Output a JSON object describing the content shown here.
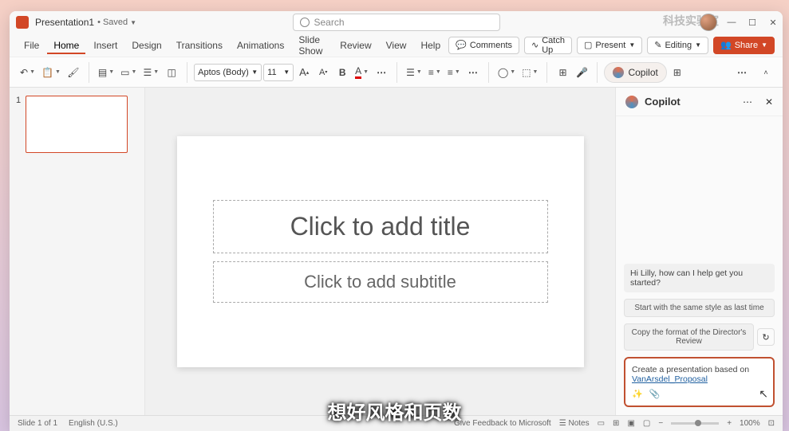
{
  "titlebar": {
    "doc_name": "Presentation1",
    "status": "• Saved",
    "search_placeholder": "Search",
    "watermark": "科技实验室"
  },
  "menu": {
    "items": [
      "File",
      "Home",
      "Insert",
      "Design",
      "Transitions",
      "Animations",
      "Slide Show",
      "Review",
      "View",
      "Help"
    ],
    "active_index": 1,
    "comments": "Comments",
    "catchup": "Catch Up",
    "present": "Present",
    "editing": "Editing",
    "share": "Share"
  },
  "ribbon": {
    "font_name": "Aptos (Body)",
    "font_size": "11",
    "copilot": "Copilot"
  },
  "thumbnail": {
    "number": "1"
  },
  "slide": {
    "title_placeholder": "Click to add title",
    "subtitle_placeholder": "Click to add subtitle"
  },
  "copilot_panel": {
    "title": "Copilot",
    "greeting": "Hi Lilly, how can I help get you started?",
    "suggestion1": "Start with the same style as last time",
    "suggestion2": "Copy the format of the Director's Review",
    "input_text": "Create a presentation based on",
    "input_link": "VanArsdel_Proposal"
  },
  "statusbar": {
    "slide_info": "Slide 1 of 1",
    "language": "English (U.S.)",
    "feedback": "Give Feedback to Microsoft",
    "notes": "Notes",
    "zoom": "100%"
  },
  "overlay_subtitle": "想好风格和页数"
}
